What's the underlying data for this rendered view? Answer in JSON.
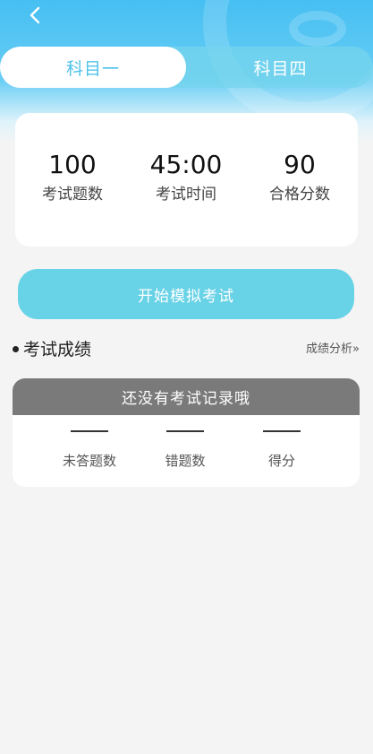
{
  "nav": {
    "back_icon": "chevron-left-icon"
  },
  "tabs": [
    {
      "label": "科目一",
      "active": true
    },
    {
      "label": "科目四",
      "active": false
    }
  ],
  "stats": [
    {
      "value": "100",
      "label": "考试题数"
    },
    {
      "value": "45:00",
      "label": "考试时间"
    },
    {
      "value": "90",
      "label": "合格分数"
    }
  ],
  "start_button": {
    "label": "开始模拟考试"
  },
  "section": {
    "title": "考试成绩",
    "link": "成绩分析»"
  },
  "record": {
    "empty_message": "还没有考试记录哦",
    "columns": [
      {
        "label": "未答题数"
      },
      {
        "label": "错题数"
      },
      {
        "label": "得分"
      }
    ]
  },
  "colors": {
    "accent": "#4ec3ea",
    "button": "#68d2e6",
    "record_header": "#7a7a7a"
  }
}
